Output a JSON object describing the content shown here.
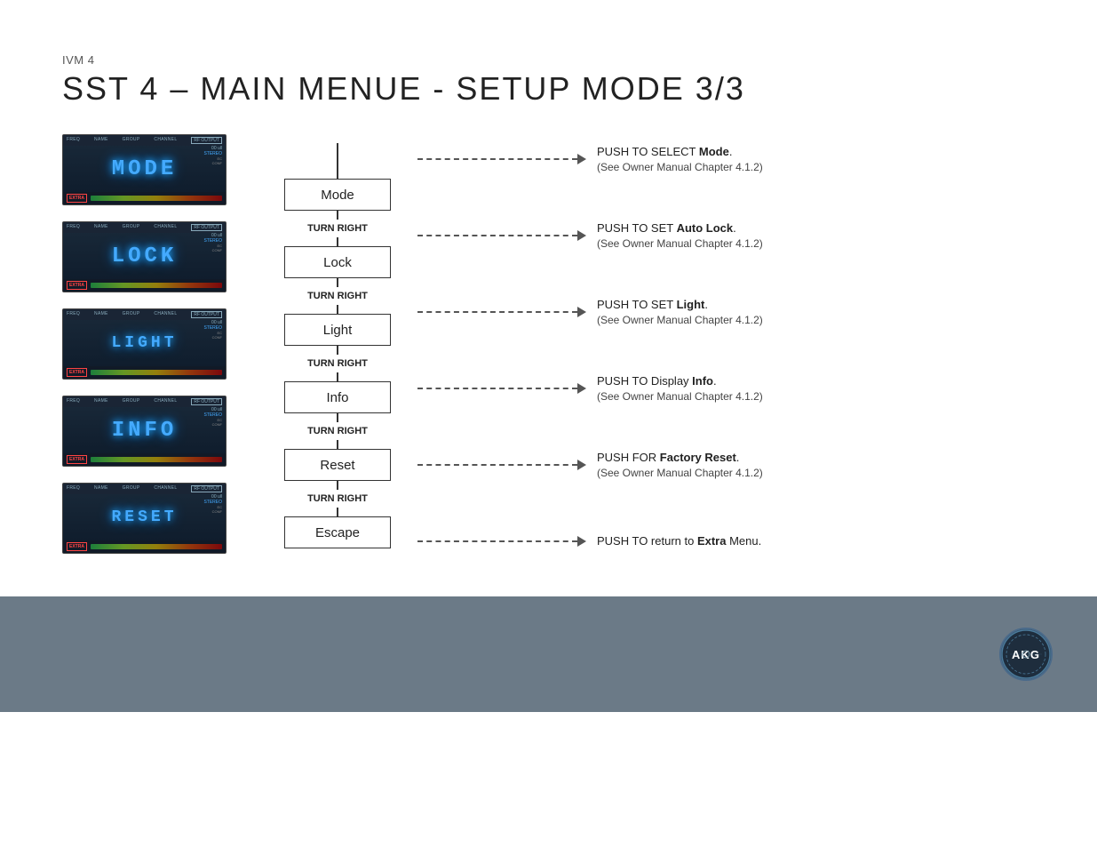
{
  "header": {
    "subtitle": "IVM 4",
    "title": "SST 4 – MAIN MENUE - SETUP MODE 3/3"
  },
  "screens": [
    {
      "id": "screen-mode",
      "main_text": "MODE",
      "text_style": "blue"
    },
    {
      "id": "screen-lock",
      "main_text": "LOCK",
      "text_style": "blue"
    },
    {
      "id": "screen-light",
      "main_text": "LIGHT",
      "text_style": "blue"
    },
    {
      "id": "screen-info",
      "main_text": "INFO",
      "text_style": "blue"
    },
    {
      "id": "screen-reset",
      "main_text": "RESET",
      "text_style": "blue"
    }
  ],
  "flow_boxes": [
    {
      "id": "box-mode",
      "label": "Mode"
    },
    {
      "id": "box-lock",
      "label": "Lock"
    },
    {
      "id": "box-light",
      "label": "Light"
    },
    {
      "id": "box-info",
      "label": "Info"
    },
    {
      "id": "box-reset",
      "label": "Reset"
    },
    {
      "id": "box-escape",
      "label": "Escape"
    }
  ],
  "between_labels": [
    "TURN RIGHT",
    "TURN RIGHT",
    "TURN RIGHT",
    "TURN RIGHT",
    "TURN RIGHT"
  ],
  "arrows": [
    {
      "main": "PUSH TO SELECT ",
      "bold": "Mode",
      "suffix": ".",
      "sub": "(See Owner Manual Chapter 4.1.2)"
    },
    {
      "main": "PUSH TO SET ",
      "bold": "Auto Lock",
      "suffix": ".",
      "sub": "(See Owner Manual Chapter 4.1.2)"
    },
    {
      "main": "PUSH TO SET ",
      "bold": "Light",
      "suffix": ".",
      "sub": "(See Owner Manual Chapter 4.1.2)"
    },
    {
      "main": "PUSH TO Display ",
      "bold": "Info",
      "suffix": ".",
      "sub": "(See Owner Manual Chapter 4.1.2)"
    },
    {
      "main": "PUSH FOR ",
      "bold": "Factory Reset",
      "suffix": ".",
      "sub": "(See Owner Manual Chapter 4.1.2)"
    },
    {
      "main": "PUSH TO return to ",
      "bold": "Extra",
      "suffix": " Menu.",
      "sub": ""
    }
  ],
  "top_arrow_label": "↓",
  "footer": {
    "logo_text": "AKG"
  }
}
